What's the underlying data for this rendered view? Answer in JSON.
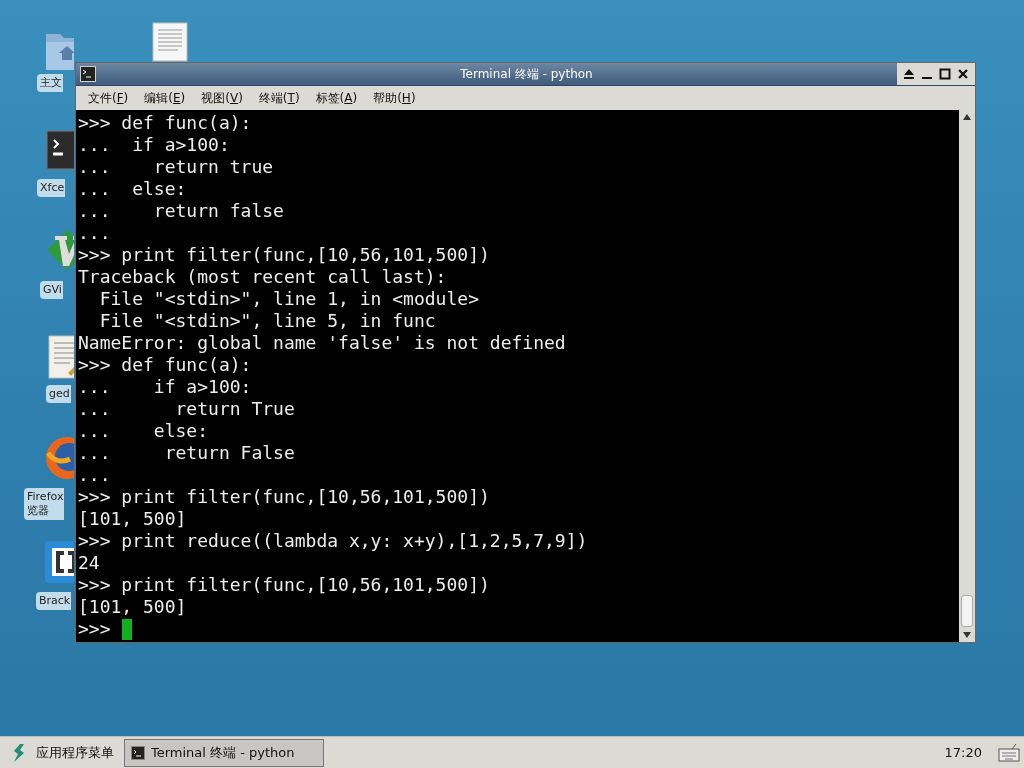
{
  "desktop_icons": [
    {
      "kind": "home-folder",
      "label": "主文"
    },
    {
      "kind": "document"
    },
    {
      "kind": "terminal",
      "label": "Xfce"
    },
    {
      "kind": "vim",
      "label": "GVi"
    },
    {
      "kind": "editor",
      "label": "ged"
    },
    {
      "kind": "browser",
      "label": "Firefox\n览器"
    },
    {
      "kind": "brackets",
      "label": "Brack"
    }
  ],
  "window": {
    "title": "Terminal 终端 - python",
    "menu": [
      {
        "before": "文件(",
        "key": "F",
        "after": ")"
      },
      {
        "before": "编辑(",
        "key": "E",
        "after": ")"
      },
      {
        "before": "视图(",
        "key": "V",
        "after": ")"
      },
      {
        "before": "终端(",
        "key": "T",
        "after": ")"
      },
      {
        "before": "标签(",
        "key": "A",
        "after": ")"
      },
      {
        "before": "帮助(",
        "key": "H",
        "after": ")"
      }
    ],
    "terminal": {
      "lines": [
        ">>> def func(a):",
        "...  if a>100:",
        "...    return true",
        "...  else:",
        "...    return false",
        "...",
        ">>> print filter(func,[10,56,101,500])",
        "Traceback (most recent call last):",
        "  File \"<stdin>\", line 1, in <module>",
        "  File \"<stdin>\", line 5, in func",
        "NameError: global name 'false' is not defined",
        ">>> def func(a):",
        "...    if a>100:",
        "...      return True",
        "...    else:",
        "...     return False",
        "...",
        ">>> print filter(func,[10,56,101,500])",
        "[101, 500]",
        ">>> print reduce((lambda x,y: x+y),[1,2,5,7,9])",
        "24",
        ">>> print filter(func,[10,56,101,500])",
        "[101, 500]"
      ],
      "prompt": ">>>",
      "cursor": true
    }
  },
  "taskbar": {
    "app_menu": "应用程序菜单",
    "tasks": [
      {
        "label": "Terminal 终端 - python",
        "selected": true
      }
    ],
    "clock": "17:20"
  }
}
